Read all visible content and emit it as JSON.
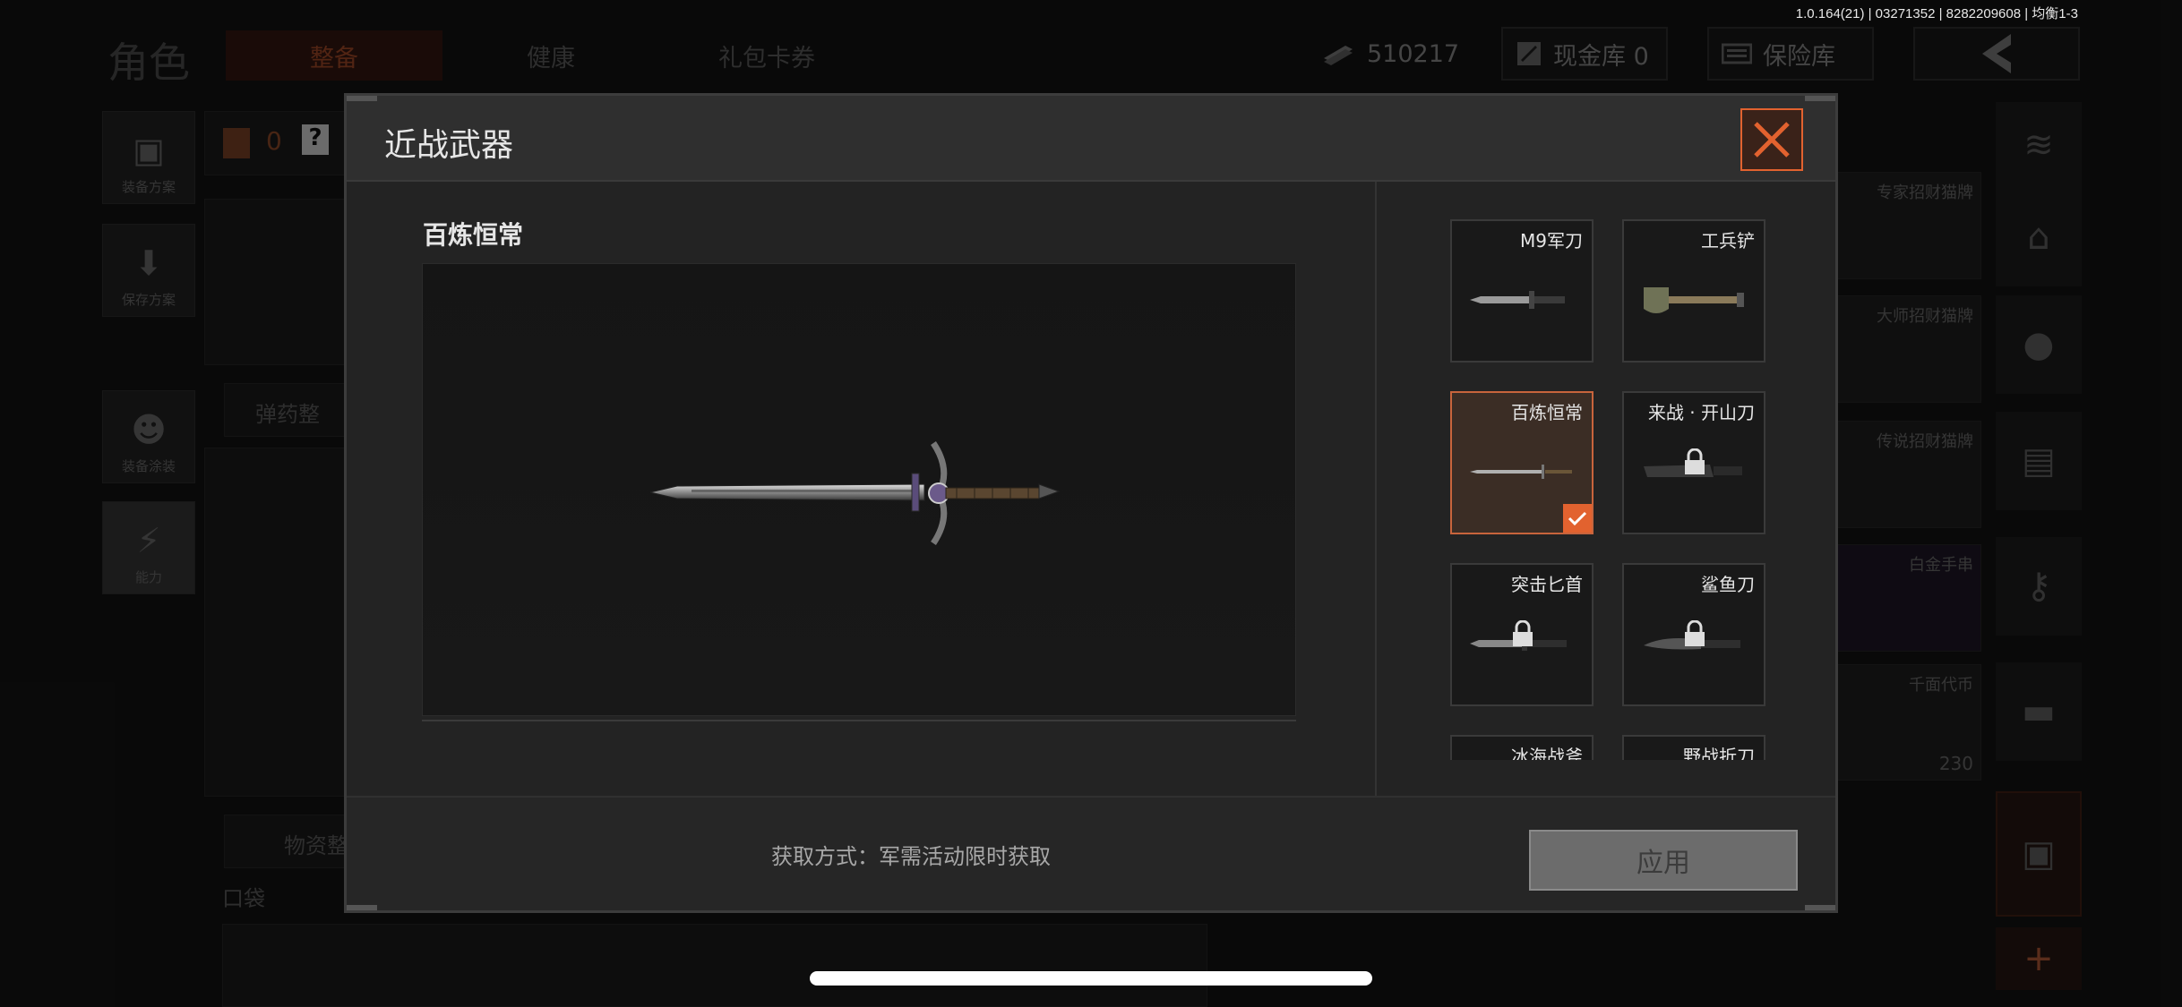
{
  "status_bar": {
    "version": "1.0.164(21) | 03271352 | 8282209608 | 均衡1-3"
  },
  "background": {
    "title": "角色",
    "tabs": [
      {
        "label": "整备",
        "active": true
      },
      {
        "label": "健康",
        "active": false
      },
      {
        "label": "礼包卡券",
        "active": false
      }
    ],
    "currency": {
      "amount": "510217",
      "cash_vault": "现金库 0",
      "insurance": "保险库"
    },
    "left_menu": [
      "装备方案",
      "保存方案",
      "装备涂装",
      "能力"
    ],
    "inventory_count": "0",
    "section_ammo": "弹药整",
    "section_supplies": "物资整",
    "pocket": "口袋",
    "right_items": [
      {
        "name": "专家招财猫牌"
      },
      {
        "name": "大师招财猫牌"
      },
      {
        "name": "传说招财猫牌"
      },
      {
        "name": "白金手串"
      },
      {
        "name": "千面代币",
        "count": "230"
      }
    ]
  },
  "modal": {
    "title": "近战武器",
    "preview_name": "百炼恒常",
    "acquire_text": "获取方式：军需活动限时获取",
    "apply_label": "应用",
    "items": [
      {
        "name": "M9军刀",
        "locked": false,
        "selected": false,
        "art": "bayonet"
      },
      {
        "name": "工兵铲",
        "locked": false,
        "selected": false,
        "art": "shovel"
      },
      {
        "name": "百炼恒常",
        "locked": false,
        "selected": true,
        "art": "sword"
      },
      {
        "name": "来战 · 开山刀",
        "locked": true,
        "selected": false,
        "art": "machete"
      },
      {
        "name": "突击匕首",
        "locked": true,
        "selected": false,
        "art": "dagger"
      },
      {
        "name": "鲨鱼刀",
        "locked": true,
        "selected": false,
        "art": "shark"
      },
      {
        "name": "冰海战斧",
        "locked": true,
        "selected": false,
        "art": "axe"
      },
      {
        "name": "野战折刀",
        "locked": true,
        "selected": false,
        "art": "folding"
      }
    ]
  },
  "colors": {
    "accent": "#e2622f",
    "selected_bg": "#3b2d25",
    "apply_disabled": "#6c6c6c"
  }
}
